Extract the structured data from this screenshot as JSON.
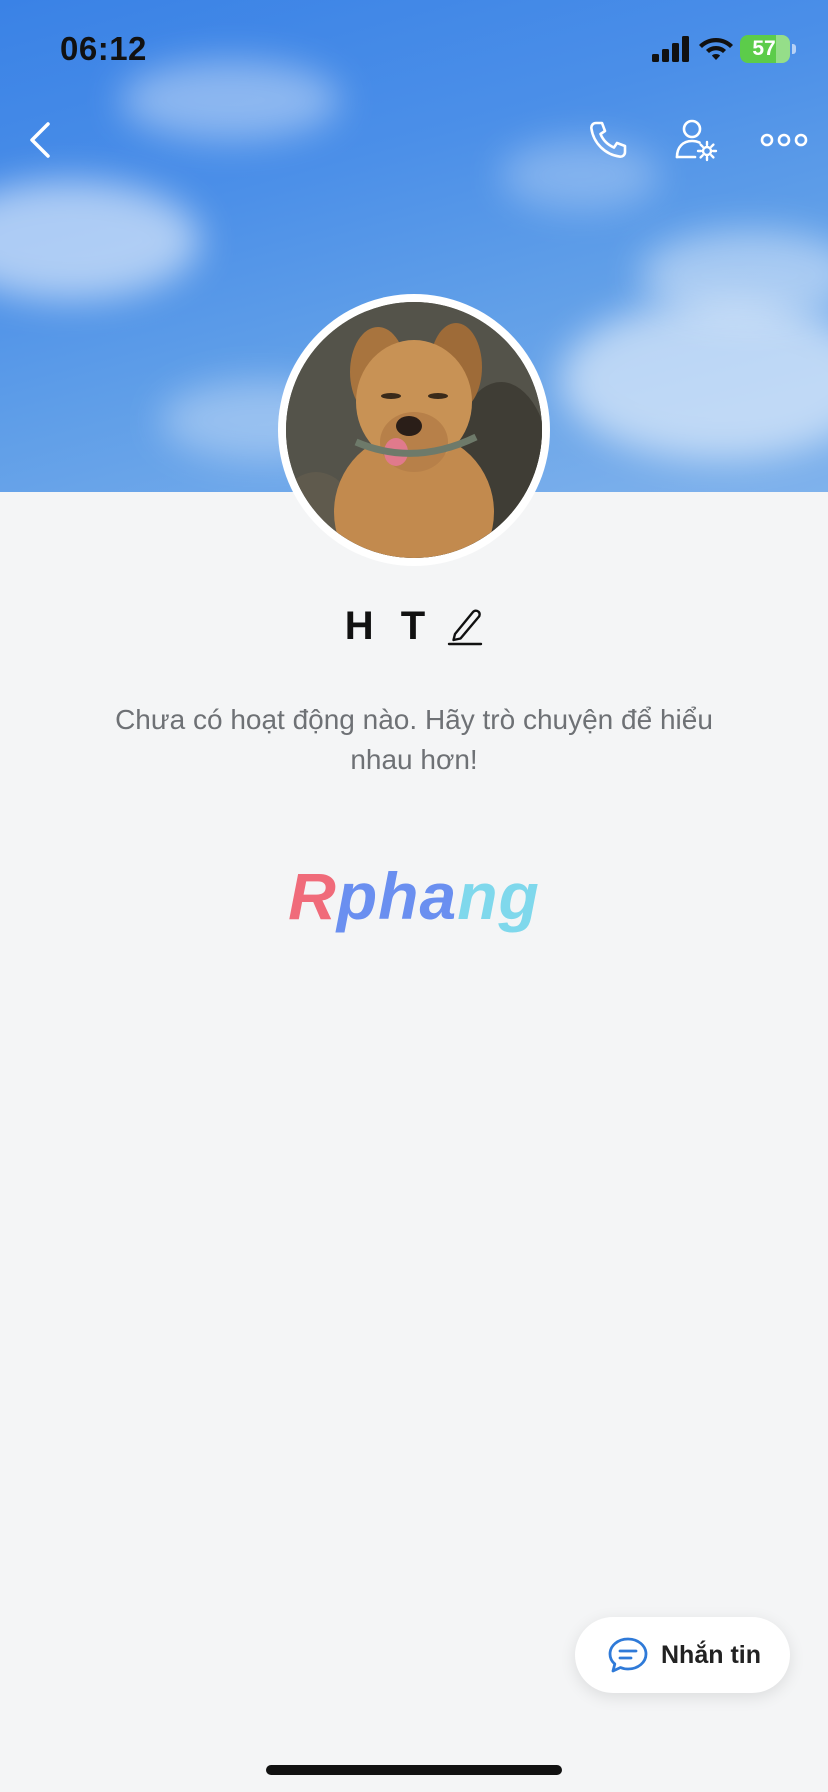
{
  "status_bar": {
    "time": "06:12",
    "battery_percent": "57",
    "signal_icon": "cellular-signal-icon",
    "wifi_icon": "wifi-icon",
    "charging": true
  },
  "header": {
    "back_icon": "chevron-left-icon",
    "call_icon": "phone-icon",
    "settings_icon": "user-settings-icon",
    "more_icon": "more-horizontal-icon"
  },
  "profile": {
    "name": "H T",
    "edit_icon": "pencil-icon",
    "empty_message": "Chưa có hoạt động nào. Hãy trò chuyện để hiểu nhau hơn!"
  },
  "watermark": {
    "part1": "R",
    "part2": "pha",
    "part3": "ng"
  },
  "actions": {
    "message_label": "Nhắn tin",
    "message_icon": "chat-bubble-icon"
  },
  "colors": {
    "cover_sky": "#3a82e6",
    "background": "#f4f5f6",
    "accent": "#2f7ad8",
    "battery": "#5ccc4a"
  }
}
